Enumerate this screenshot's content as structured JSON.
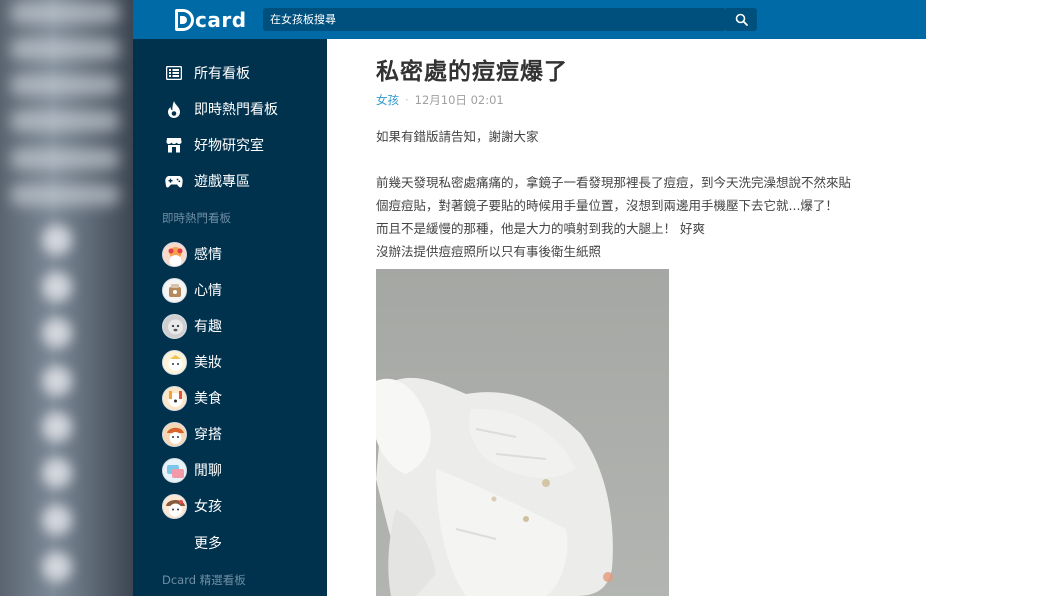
{
  "header": {
    "logo_text": "card",
    "search_placeholder": "在女孩板搜尋",
    "colors": {
      "bar": "#006aa6",
      "search": "#00507e"
    }
  },
  "sidebar": {
    "color": "#00324e",
    "main_items": [
      {
        "label": "所有看板",
        "icon": "list-icon"
      },
      {
        "label": "即時熱門看板",
        "icon": "flame-icon"
      },
      {
        "label": "好物研究室",
        "icon": "store-icon"
      },
      {
        "label": "遊戲專區",
        "icon": "gamepad-icon"
      }
    ],
    "trending_title": "即時熱門看板",
    "boards": [
      {
        "label": "感情",
        "icon": "relationship-board-avatar"
      },
      {
        "label": "心情",
        "icon": "mood-board-avatar"
      },
      {
        "label": "有趣",
        "icon": "funny-board-avatar"
      },
      {
        "label": "美妝",
        "icon": "makeup-board-avatar"
      },
      {
        "label": "美食",
        "icon": "food-board-avatar"
      },
      {
        "label": "穿搭",
        "icon": "outfit-board-avatar"
      },
      {
        "label": "閒聊",
        "icon": "chat-board-avatar"
      },
      {
        "label": "女孩",
        "icon": "girl-board-avatar"
      }
    ],
    "more_label": "更多",
    "selected_title": "Dcard 精選看板"
  },
  "post": {
    "title": "私密處的痘痘爆了",
    "forum": "女孩",
    "separator": "·",
    "time": "12月10日 02:01",
    "paragraphs": [
      "如果有錯版請告知，謝謝大家",
      "前幾天發現私密處痛痛的，拿鏡子一看發現那裡長了痘痘，到今天洗完澡想說不然來貼",
      "個痘痘貼，對著鏡子要貼的時候用手量位置，沒想到兩邊用手機壓下去它就...爆了！",
      "而且不是緩慢的那種，他是大力的噴射到我的大腿上！ 好爽",
      "沒辦法提供痘痘照所以只有事後衛生紙照"
    ],
    "image_description_icon": "tissue-photo"
  }
}
